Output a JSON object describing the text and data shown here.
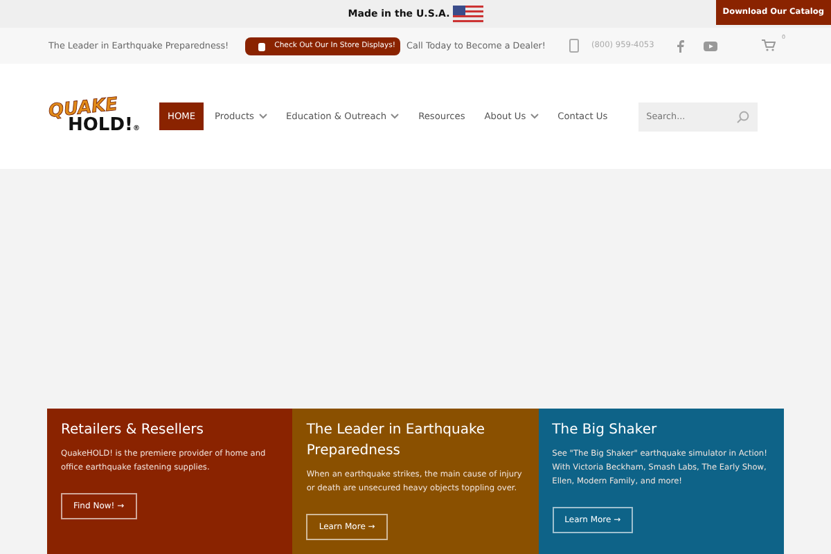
{
  "top_bar": {
    "text": "Made in the U.S.A.",
    "catalog_button": "Download Our Catalog"
  },
  "info_bar": {
    "tagline": "The Leader in Earthquake Preparedness!",
    "store_button": "Check Out Our In Store Displays!",
    "dealer_text": "Call Today to Become a Dealer!",
    "phone": "(800) 959-4053",
    "cart_count": "0"
  },
  "logo": {
    "line_1": "QUAKE",
    "line_2": "HOLD!",
    "mark": "®"
  },
  "nav": [
    {
      "label": "HOME",
      "selected": true,
      "dropdown": false
    },
    {
      "label": "Products",
      "selected": false,
      "dropdown": true
    },
    {
      "label": "Education & Outreach",
      "selected": false,
      "dropdown": true
    },
    {
      "label": "Resources",
      "selected": false,
      "dropdown": false
    },
    {
      "label": "About Us",
      "selected": false,
      "dropdown": true
    },
    {
      "label": "Contact Us",
      "selected": false,
      "dropdown": false
    }
  ],
  "search": {
    "placeholder": "Search..."
  },
  "cards": [
    {
      "title": "Retailers & Resellers",
      "text": "QuakeHOLD! is the premiere provider of home and office earthquake fastening supplies.",
      "button": "Find Now! →",
      "color": "#8a2300"
    },
    {
      "title": "The Leader in Earthquake Preparedness",
      "text": "When an earthquake strikes, the main cause of injury or death are unsecured heavy objects toppling over.",
      "button": "Learn More →",
      "color": "#8a5000"
    },
    {
      "title": "The Big Shaker",
      "text": "See \"The Big Shaker\" earthquake simulator in Action! With Victoria Beckham, Smash Labs, The Early Show, Ellen, Modern Family, and more!",
      "button": "Learn More →",
      "color": "#0e6388"
    }
  ]
}
